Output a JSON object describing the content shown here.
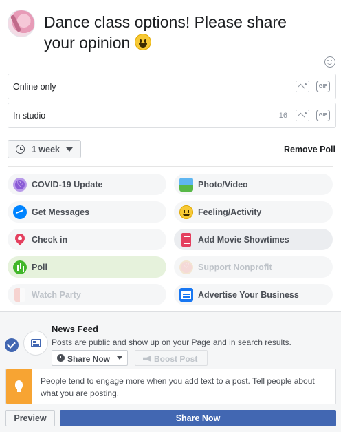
{
  "post": {
    "text": "Dance class options! Please share your opinion",
    "emoji": "grinning-face-emoji"
  },
  "poll": {
    "options": [
      {
        "text": "Online only",
        "count": ""
      },
      {
        "text": "In studio",
        "count": "16"
      }
    ],
    "duration": "1 week",
    "remove_label": "Remove Poll"
  },
  "actions": [
    {
      "label": "COVID-19 Update",
      "icon": "covid-heart-icon",
      "state": "normal"
    },
    {
      "label": "Photo/Video",
      "icon": "photo-video-icon",
      "state": "normal"
    },
    {
      "label": "Get Messages",
      "icon": "messenger-icon",
      "state": "normal"
    },
    {
      "label": "Feeling/Activity",
      "icon": "feeling-icon",
      "state": "normal"
    },
    {
      "label": "Check in",
      "icon": "location-pin-icon",
      "state": "normal"
    },
    {
      "label": "Add Movie Showtimes",
      "icon": "movie-ticket-icon",
      "state": "hover"
    },
    {
      "label": "Poll",
      "icon": "poll-icon",
      "state": "selected"
    },
    {
      "label": "Support Nonprofit",
      "icon": "nonprofit-heart-icon",
      "state": "disabled"
    },
    {
      "label": "Watch Party",
      "icon": "popcorn-icon",
      "state": "disabled"
    },
    {
      "label": "Advertise Your Business",
      "icon": "advertise-icon",
      "state": "normal"
    }
  ],
  "audience": {
    "title": "News Feed",
    "description": "Posts are public and show up on your Page and in search results.",
    "share_option": "Share Now",
    "boost_label": "Boost Post"
  },
  "tip": {
    "text": "People tend to engage more when you add text to a post. Tell people about what you are posting."
  },
  "buttons": {
    "preview": "Preview",
    "share": "Share Now"
  },
  "colors": {
    "brand": "#4267b2",
    "selected_pill": "#e6f2dc",
    "tip_accent": "#f7a433"
  }
}
